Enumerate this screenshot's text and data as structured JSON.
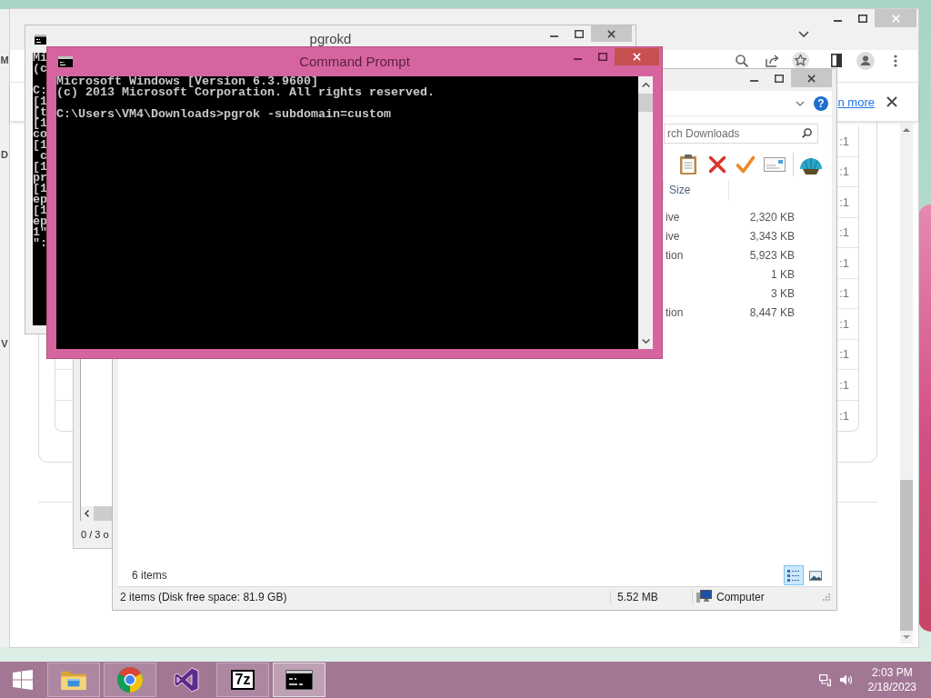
{
  "edge_window": {
    "letters": [
      "M",
      "D",
      "V"
    ]
  },
  "browser": {
    "notice": {
      "link": "n more"
    },
    "table": {
      "cells": [
        ":1",
        ":1",
        ":1",
        ":1",
        ":1",
        ":1",
        ":1",
        ":1",
        ":1",
        ":1"
      ]
    }
  },
  "pgrokd_window": {
    "title": "pgrokd",
    "blocks": [
      [
        "Mi",
        "(c"
      ],
      [
        "C:",
        "[1",
        "[t",
        "[1",
        "co",
        "[1",
        " c",
        "[1",
        "pr",
        "[1",
        "ep",
        "[1",
        "ep",
        "1\"",
        "\":"
      ]
    ]
  },
  "list_window": {
    "status": "0 / 3 o"
  },
  "explorer": {
    "help": "?",
    "search": {
      "placeholder": "rch Downloads"
    },
    "columns": [
      "Size"
    ],
    "rows": [
      {
        "type": "ive",
        "size": "2,320 KB"
      },
      {
        "type": "ive",
        "size": "3,343 KB"
      },
      {
        "type": "tion",
        "size": "5,923 KB"
      },
      {
        "size": "1 KB"
      },
      {
        "size": "3 KB"
      },
      {
        "type": "tion",
        "size": "8,447 KB"
      }
    ],
    "item_count": "6 items",
    "views": [
      {
        "kind": "details",
        "selected": true
      },
      {
        "kind": "preview",
        "selected": false
      }
    ],
    "status_bar": {
      "selection": "2 items (Disk free space: 81.9 GB)",
      "size": "5.52 MB",
      "location": "Computer"
    }
  },
  "command_prompt": {
    "title": "Command Prompt",
    "blocks": [
      [
        "Microsoft Windows [Version 6.3.9600]",
        "(c) 2013 Microsoft Corporation. All rights reserved."
      ],
      [
        "C:\\Users\\VM4\\Downloads>pgrok -subdomain=custom"
      ]
    ]
  },
  "taskbar": {
    "apps": [
      {
        "kind": "explorer",
        "running": true,
        "selected": false
      },
      {
        "kind": "browser",
        "running": true,
        "selected": false
      },
      {
        "kind": "ide",
        "running": false,
        "selected": false
      },
      {
        "kind": "archiver",
        "label": "7z",
        "running": true,
        "selected": false
      },
      {
        "kind": "console",
        "running": true,
        "selected": true
      }
    ],
    "clock": {
      "time": "2:03 PM",
      "date": "2/18/2023"
    }
  }
}
